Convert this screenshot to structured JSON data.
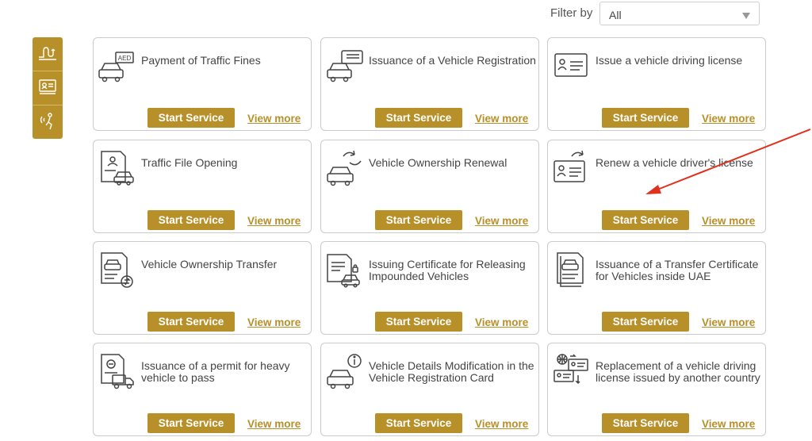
{
  "filter": {
    "label": "Filter by",
    "selected": "All"
  },
  "sidebar": {
    "items": [
      {
        "icon": "road-route-icon"
      },
      {
        "icon": "vehicle-document-icon"
      },
      {
        "icon": "signal-person-icon"
      }
    ]
  },
  "services": [
    {
      "title": "Payment of Traffic Fines",
      "icon": "fine-car-icon",
      "fine_tag": "AED",
      "start_label": "Start Service",
      "more_label": "View more"
    },
    {
      "title": "Issuance of a Vehicle Registration",
      "icon": "car-registration-icon",
      "start_label": "Start Service",
      "more_label": "View more"
    },
    {
      "title": "Issue a vehicle driving license",
      "icon": "license-card-icon",
      "start_label": "Start Service",
      "more_label": "View more"
    },
    {
      "title": "Traffic File Opening",
      "icon": "traffic-file-icon",
      "start_label": "Start Service",
      "more_label": "View more"
    },
    {
      "title": "Vehicle Ownership Renewal",
      "icon": "car-renew-icon",
      "start_label": "Start Service",
      "more_label": "View more"
    },
    {
      "title": "Renew a vehicle driver's license",
      "icon": "license-renew-icon",
      "start_label": "Start Service",
      "more_label": "View more"
    },
    {
      "title": "Vehicle Ownership Transfer",
      "icon": "ownership-transfer-icon",
      "start_label": "Start Service",
      "more_label": "View more"
    },
    {
      "title": "Issuing Certificate for Releasing Impounded Vehicles",
      "icon": "release-certificate-icon",
      "start_label": "Start Service",
      "more_label": "View more"
    },
    {
      "title": "Issuance of a Transfer Certificate for Vehicles inside UAE",
      "icon": "transfer-certificate-icon",
      "start_label": "Start Service",
      "more_label": "View more"
    },
    {
      "title": "Issuance of a permit for heavy vehicle to pass",
      "icon": "heavy-vehicle-permit-icon",
      "start_label": "Start Service",
      "more_label": "View more"
    },
    {
      "title": "Vehicle Details Modification in the Vehicle Registration Card",
      "icon": "car-info-icon",
      "start_label": "Start Service",
      "more_label": "View more"
    },
    {
      "title": "Replacement of a vehicle driving license issued by another country",
      "icon": "license-exchange-icon",
      "start_label": "Start Service",
      "more_label": "View more"
    }
  ],
  "colors": {
    "accent": "#b8902a",
    "annotation": "#e0301e",
    "text": "#444444",
    "border": "#cbcbcb"
  }
}
